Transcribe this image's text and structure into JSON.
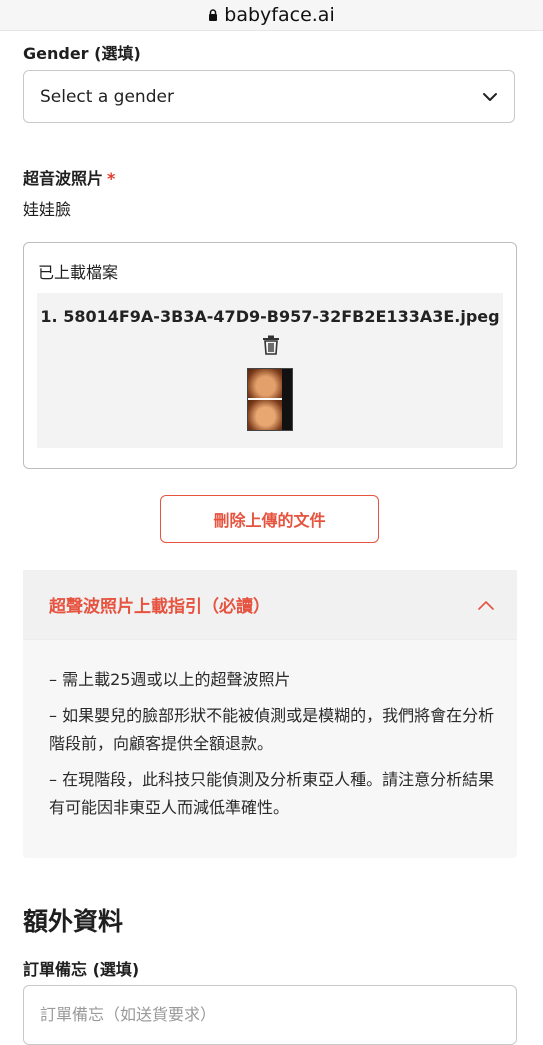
{
  "browser": {
    "url": "babyface.ai"
  },
  "gender": {
    "label": "Gender (選填)",
    "selected": "Select a gender"
  },
  "ultrasound": {
    "label": "超音波照片",
    "required_mark": "*",
    "subtitle": "娃娃臉"
  },
  "uploaded": {
    "title": "已上載檔案",
    "file_name": "1. 58014F9A-3B3A-47D9-B957-32FB2E133A3E.jpeg"
  },
  "delete_button_label": "刪除上傳的文件",
  "guide": {
    "title": "超聲波照片上載指引（必讀）",
    "items": [
      "– 需上載25週或以上的超聲波照片",
      "– 如果嬰兒的臉部形狀不能被偵測或是模糊的，我們將會在分析階段前，向顧客提供全額退款。",
      "– 在現階段，此科技只能偵測及分析東亞人種。請注意分析結果有可能因非東亞人而減低準確性。"
    ]
  },
  "extra": {
    "heading": "額外資料",
    "notes_label": "訂單備忘 (選填)",
    "notes_placeholder": "訂單備忘（如送貨要求）"
  },
  "colors": {
    "accent": "#e6533f",
    "required": "#e43b2c"
  }
}
